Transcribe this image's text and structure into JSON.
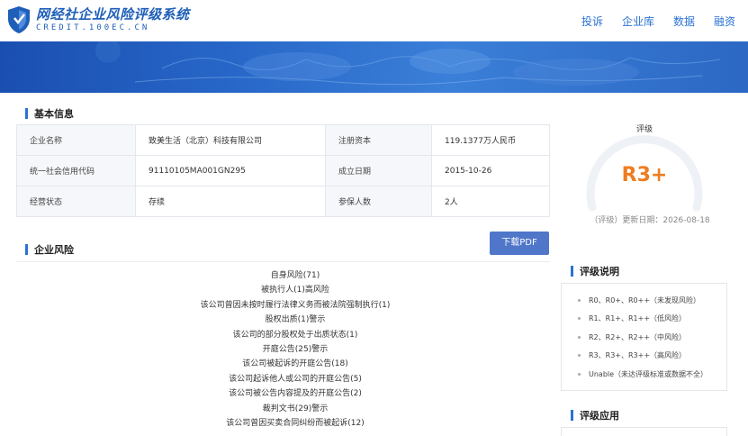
{
  "header": {
    "logo_cn": "网经社企业风险评级系统",
    "logo_en": "CREDIT.100EC.CN",
    "nav": [
      "投诉",
      "企业库",
      "数据",
      "融资"
    ]
  },
  "basic_info": {
    "title": "基本信息",
    "rows": [
      {
        "label1": "企业名称",
        "value1": "致美生活（北京）科技有限公司",
        "label2": "注册资本",
        "value2": "119.1377万人民币"
      },
      {
        "label1": "统一社会信用代码",
        "value1": "91110105MA001GN295",
        "label2": "成立日期",
        "value2": "2015-10-26"
      },
      {
        "label1": "经营状态",
        "value1": "存续",
        "label2": "参保人数",
        "value2": "2人"
      }
    ]
  },
  "risk": {
    "title": "企业风险",
    "download_label": "下载PDF",
    "items": [
      "自身风险(71)",
      "被执行人(1)高风险",
      "该公司曾因未按时履行法律义务而被法院强制执行(1)",
      "股权出质(1)警示",
      "该公司的部分股权处于出质状态(1)",
      "开庭公告(25)警示",
      "该公司被起诉的开庭公告(18)",
      "该公司起诉他人或公司的开庭公告(5)",
      "该公司被公告内容提及的开庭公告(2)",
      "裁判文书(29)警示",
      "该公司曾因买卖合同纠纷而被起诉(12)"
    ]
  },
  "rating": {
    "label": "评级",
    "value": "R3+",
    "date_text": "（评级）更新日期：2026-08-18",
    "value_color": "#ee7d20"
  },
  "rating_legend": {
    "title": "评级说明",
    "items": [
      "R0、R0+、R0++（未发现风险）",
      "R1、R1+、R1++（低风险）",
      "R2、R2+、R2++（中风险）",
      "R3、R3+、R3++（高风险）",
      "Unable（未达评级标准或数据不全）"
    ]
  },
  "rating_apply": {
    "title": "评级应用"
  }
}
